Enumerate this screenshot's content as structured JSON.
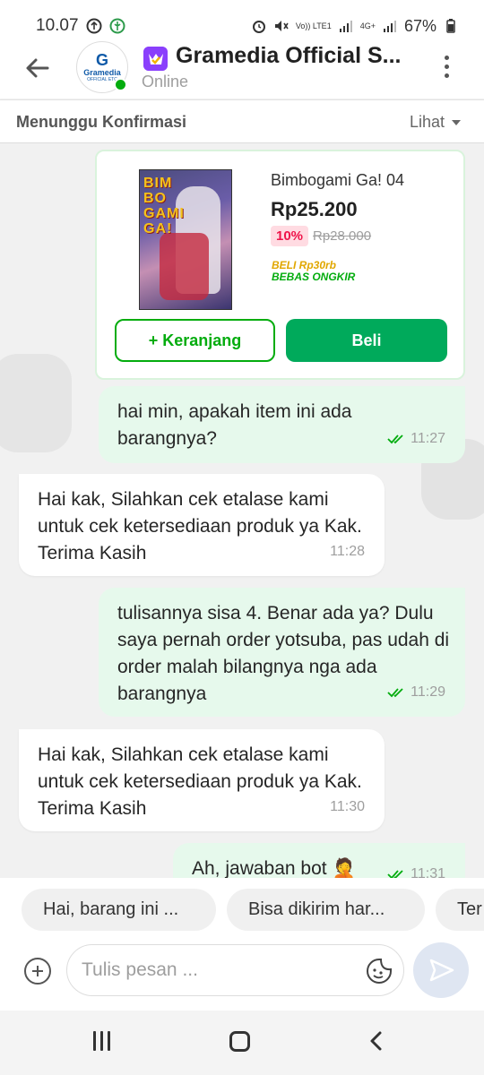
{
  "status_bar": {
    "time": "10.07",
    "battery": "67%",
    "network_label": "Vo)) LTE1",
    "network_type": "4G+"
  },
  "header": {
    "back_icon": "arrow-left-icon",
    "avatar": {
      "letter": "G",
      "brand": "Gramedia",
      "tagline": "OFFICIAL ETC"
    },
    "store_name": "Gramedia Official S...",
    "store_status": "Online",
    "menu_icon": "more-vertical-icon"
  },
  "order_bar": {
    "status": "Menunggu Konfirmasi",
    "action": "Lihat"
  },
  "product": {
    "cover_title": "BIM BO GAMI GA!",
    "name": "Bimbogami Ga! 04",
    "price": "Rp25.200",
    "discount": "10%",
    "original_price": "Rp28.000",
    "promo_line1": "BELI Rp30rb",
    "promo_line2": "BEBAS ONGKIR",
    "cart_button": "+ Keranjang",
    "buy_button": "Beli"
  },
  "messages": [
    {
      "side": "out",
      "text": "hai min, apakah item ini ada barangnya?",
      "time": "11:27"
    },
    {
      "side": "in",
      "text": "Hai kak, Silahkan cek etalase kami untuk cek ketersediaan produk ya Kak. Terima Kasih",
      "time": "11:28"
    },
    {
      "side": "out",
      "text": "tulisannya sisa 4. Benar ada ya? Dulu saya pernah order yotsuba, pas udah di order malah bilangnya nga ada barangnya",
      "time": "11:29"
    },
    {
      "side": "in",
      "text": "Hai kak, Silahkan cek etalase kami untuk cek ketersediaan produk ya Kak. Terima Kasih",
      "time": "11:30"
    },
    {
      "side": "out",
      "text": "Ah, jawaban bot 🤦",
      "time": "11:31"
    }
  ],
  "quick_replies": [
    "Hai, barang ini ...",
    "Bisa dikirim har...",
    "Ter"
  ],
  "composer": {
    "placeholder": "Tulis pesan ...",
    "attach_icon": "plus-circle-icon",
    "sticker_icon": "sticker-icon",
    "send_icon": "send-icon"
  },
  "nav": {
    "recent_icon": "recent-apps-icon",
    "home_icon": "home-icon",
    "back_icon": "back-icon"
  },
  "colors": {
    "primary_green": "#03AC0E",
    "buy_green": "#00AA5B",
    "bubble_out": "#E6F9EC",
    "discount_red": "#EF144A",
    "store_badge": "#8A3FFC"
  }
}
